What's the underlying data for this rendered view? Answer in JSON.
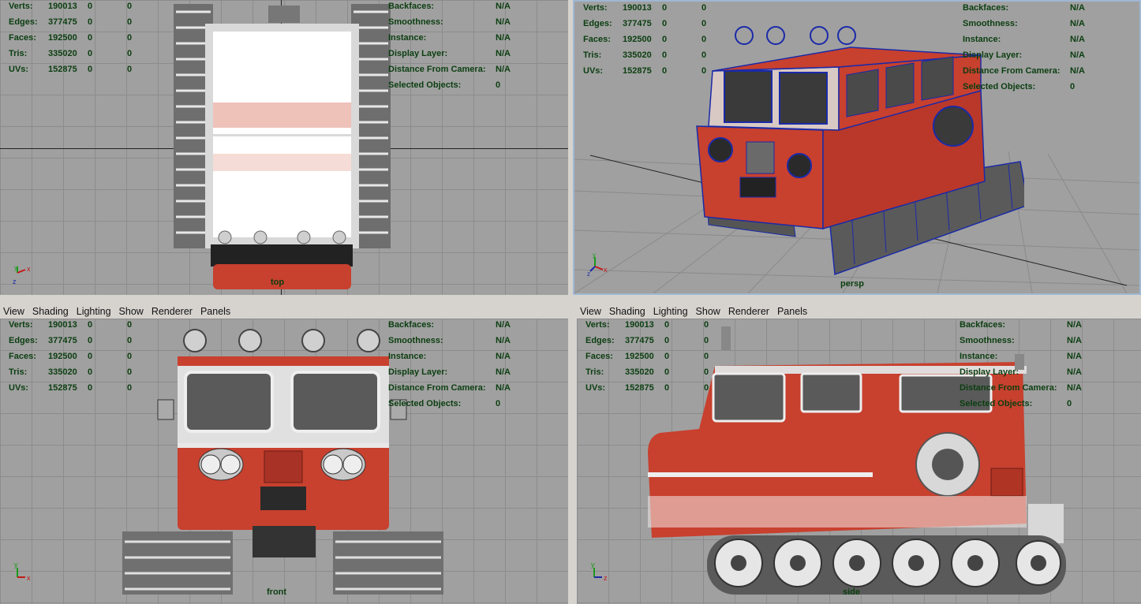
{
  "hud": {
    "left": [
      {
        "label": "Verts:",
        "v1": "190013",
        "v2": "0",
        "v3": "0"
      },
      {
        "label": "Edges:",
        "v1": "377475",
        "v2": "0",
        "v3": "0"
      },
      {
        "label": "Faces:",
        "v1": "192500",
        "v2": "0",
        "v3": "0"
      },
      {
        "label": "Tris:",
        "v1": "335020",
        "v2": "0",
        "v3": "0"
      },
      {
        "label": "UVs:",
        "v1": "152875",
        "v2": "0",
        "v3": "0"
      }
    ],
    "right": [
      {
        "label": "Backfaces:",
        "value": "N/A"
      },
      {
        "label": "Smoothness:",
        "value": "N/A"
      },
      {
        "label": "Instance:",
        "value": "N/A"
      },
      {
        "label": "Display Layer:",
        "value": "N/A"
      },
      {
        "label": "Distance From Camera:",
        "value": "N/A"
      },
      {
        "label": "Selected Objects:",
        "value": "0"
      }
    ]
  },
  "menu": [
    "View",
    "Shading",
    "Lighting",
    "Show",
    "Renderer",
    "Panels"
  ],
  "cameras": {
    "top": "top",
    "persp": "persp",
    "front": "front",
    "side": "side"
  },
  "axes": {
    "top": [
      "y",
      "x",
      "z"
    ],
    "persp": [
      "y",
      "x",
      "z"
    ],
    "front": [
      "y",
      "x"
    ],
    "side": [
      "y",
      "z"
    ]
  },
  "colors": {
    "hud_text": "#0b3e10",
    "viewport_bg": "#a0a0a0",
    "vehicle_red": "#c8402e",
    "wire_blue": "#1a2aa8"
  }
}
